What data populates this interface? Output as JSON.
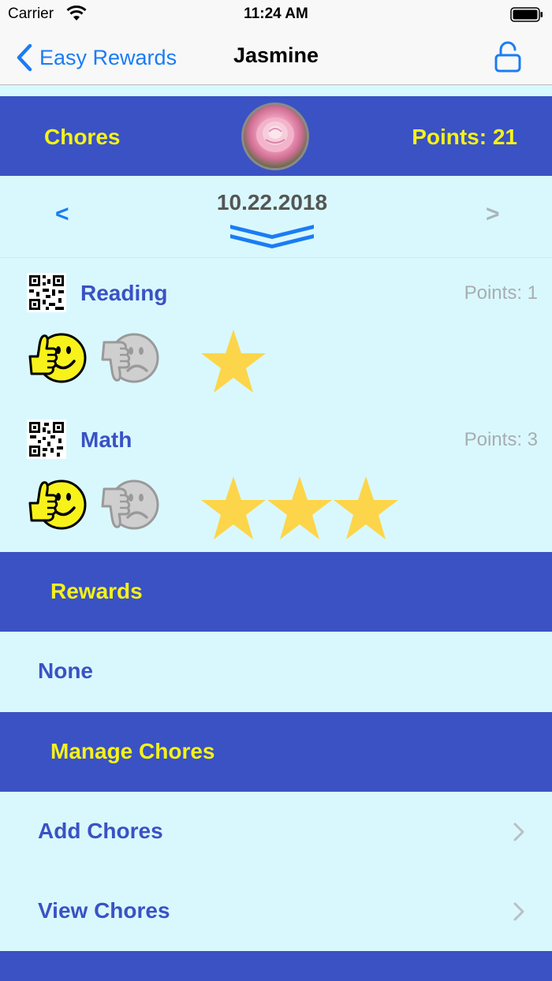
{
  "status_bar": {
    "carrier": "Carrier",
    "time": "11:24 AM"
  },
  "nav": {
    "back_label": "Easy Rewards",
    "title": "Jasmine"
  },
  "header": {
    "chores_label": "Chores",
    "points_label": "Points: 21"
  },
  "date_nav": {
    "prev": "<",
    "next": ">",
    "date": "10.22.2018"
  },
  "chores": [
    {
      "name": "Reading",
      "points": "Points: 1",
      "stars": 1
    },
    {
      "name": "Math",
      "points": "Points: 3",
      "stars": 3
    }
  ],
  "rewards": {
    "header": "Rewards",
    "items": [
      "None"
    ]
  },
  "manage": {
    "header": "Manage Chores",
    "items": [
      "Add Chores",
      "View Chores"
    ]
  },
  "colors": {
    "accent_blue": "#3a52c4",
    "yellow": "#f5f218",
    "background": "#d9f8fd",
    "ios_blue": "#1a7cf5",
    "star": "#fcd54a"
  }
}
